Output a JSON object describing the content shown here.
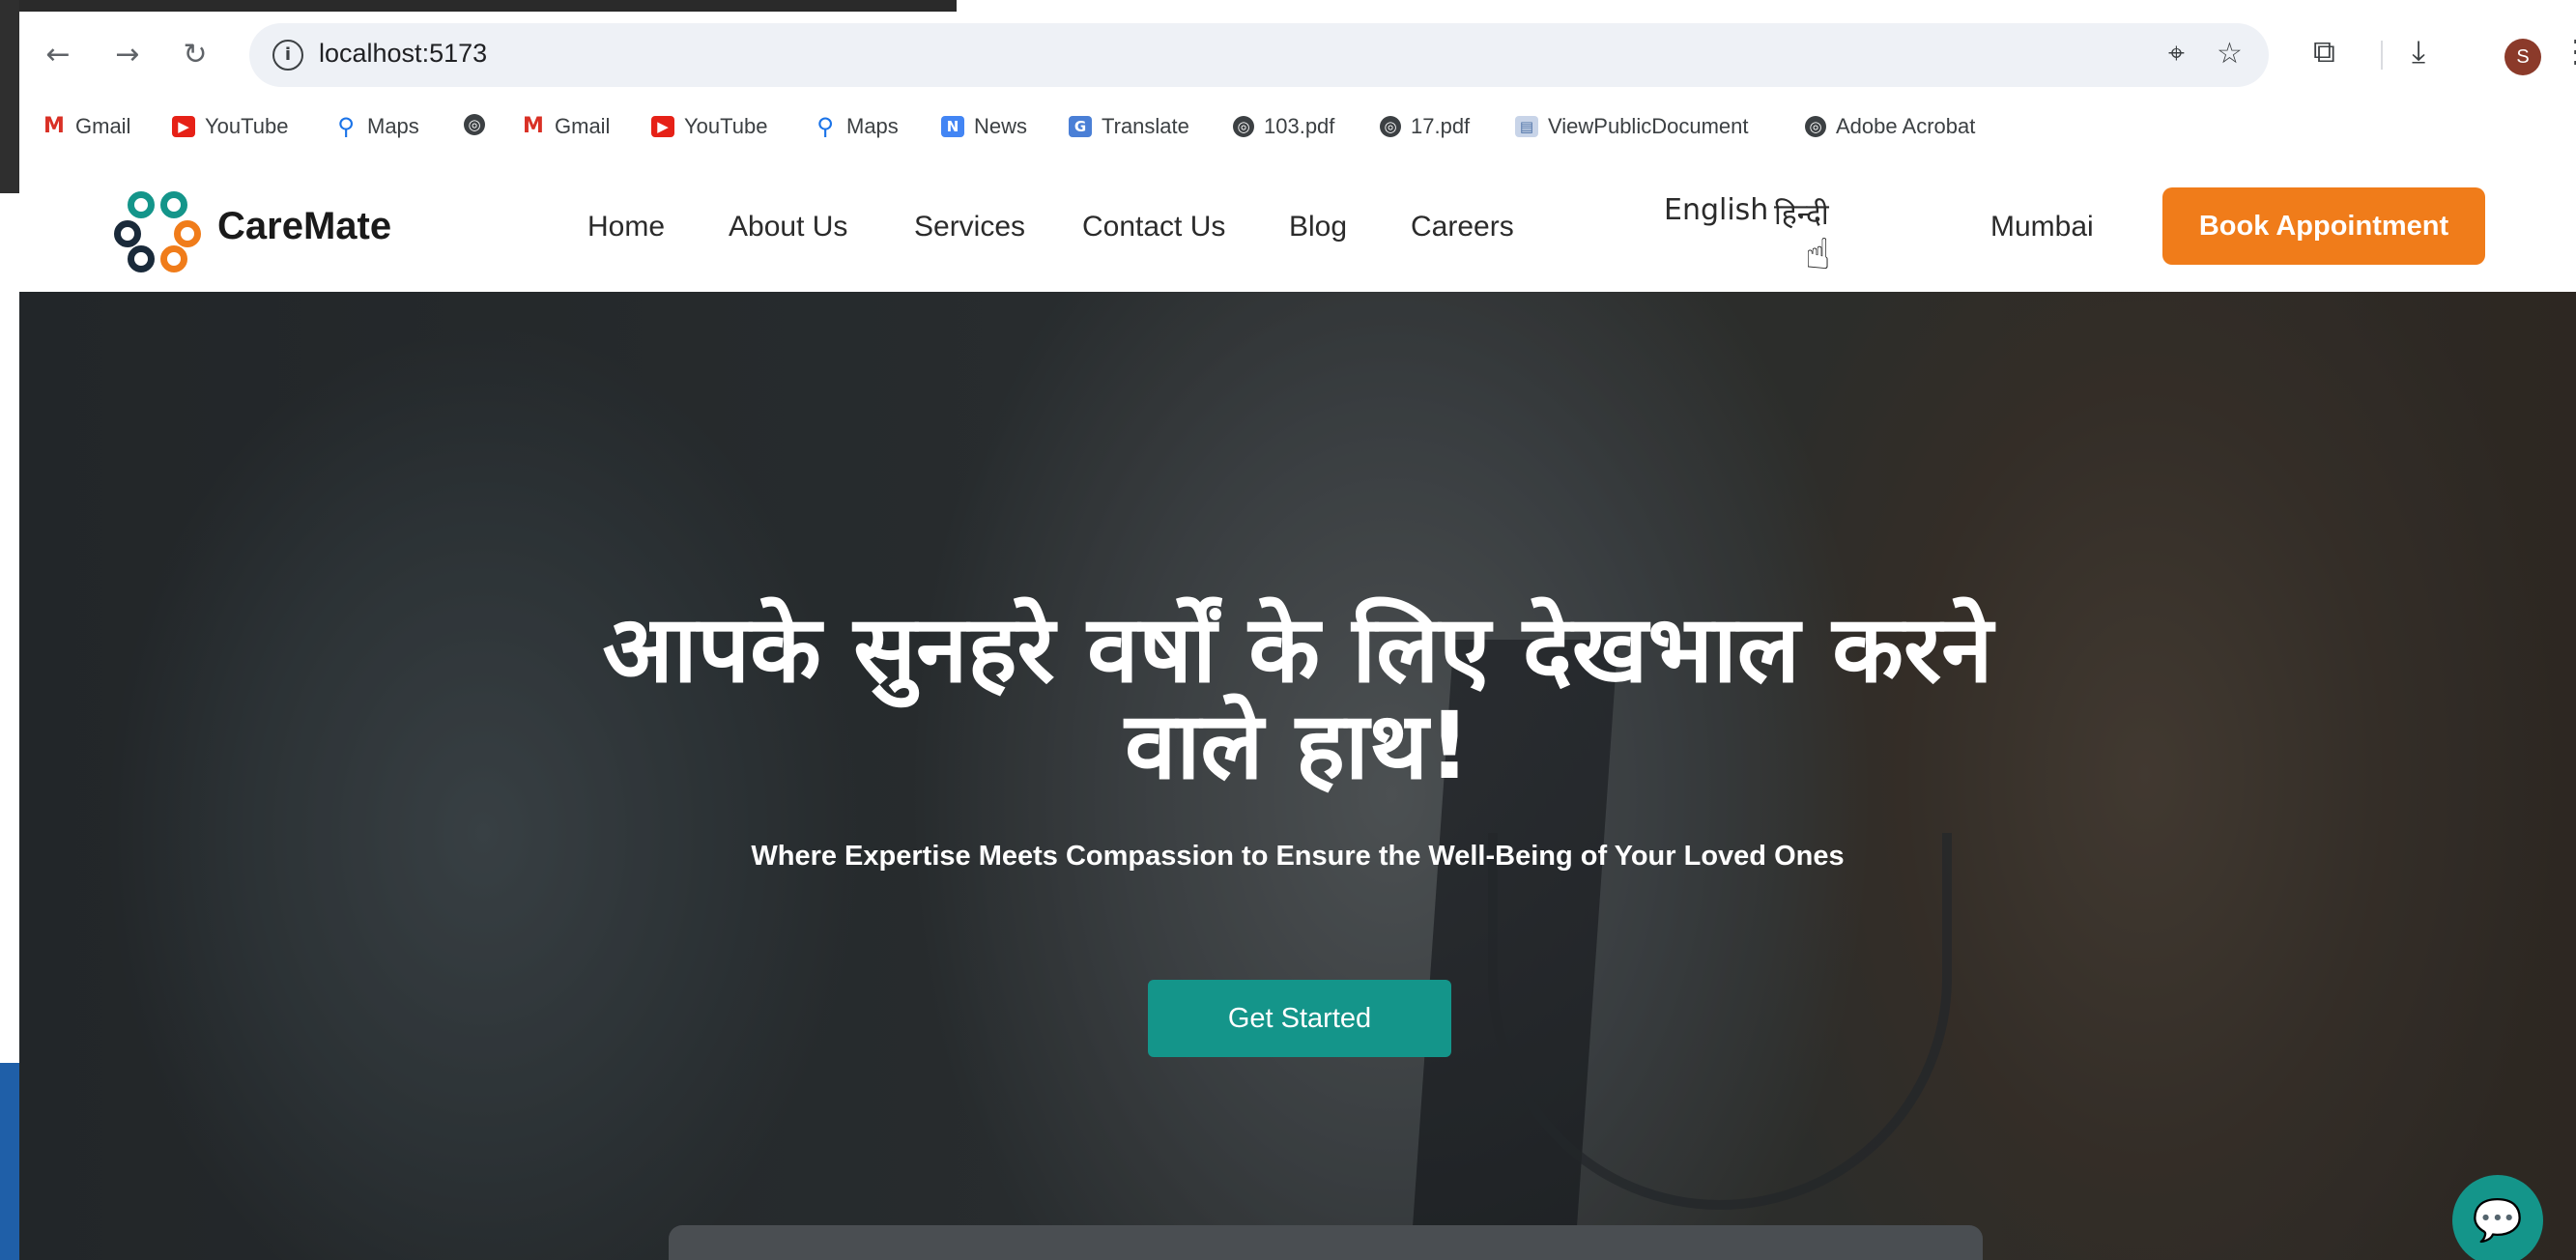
{
  "browser": {
    "url": "localhost:5173",
    "profile_initial": "S",
    "bookmarks": [
      {
        "label": "Gmail",
        "icon": "gmail-icon"
      },
      {
        "label": "YouTube",
        "icon": "youtube-icon"
      },
      {
        "label": "Maps",
        "icon": "maps-icon"
      },
      {
        "label": "",
        "icon": "globe-icon"
      },
      {
        "label": "Gmail",
        "icon": "gmail-icon"
      },
      {
        "label": "YouTube",
        "icon": "youtube-icon"
      },
      {
        "label": "Maps",
        "icon": "maps-icon"
      },
      {
        "label": "News",
        "icon": "news-icon"
      },
      {
        "label": "Translate",
        "icon": "translate-icon"
      },
      {
        "label": "103.pdf",
        "icon": "globe-icon"
      },
      {
        "label": "17.pdf",
        "icon": "globe-icon"
      },
      {
        "label": "ViewPublicDocument",
        "icon": "document-icon"
      },
      {
        "label": "Adobe Acrobat",
        "icon": "globe-icon"
      }
    ]
  },
  "site": {
    "brand": "CareMate",
    "nav": [
      "Home",
      "About Us",
      "Services",
      "Contact Us",
      "Blog",
      "Careers"
    ],
    "lang_english": "English",
    "lang_hindi": "हिन्दी",
    "city": "Mumbai",
    "book_label": "Book Appointment"
  },
  "hero": {
    "title_line1": "आपके सुनहरे वर्षों के लिए देखभाल करने",
    "title_line2": "वाले हाथ!",
    "subtitle": "Where Expertise Meets Compassion to Ensure the Well-Being of Your Loved Ones",
    "cta_label": "Get Started"
  },
  "colors": {
    "accent_orange": "#f07c1a",
    "accent_teal": "#14958a"
  }
}
